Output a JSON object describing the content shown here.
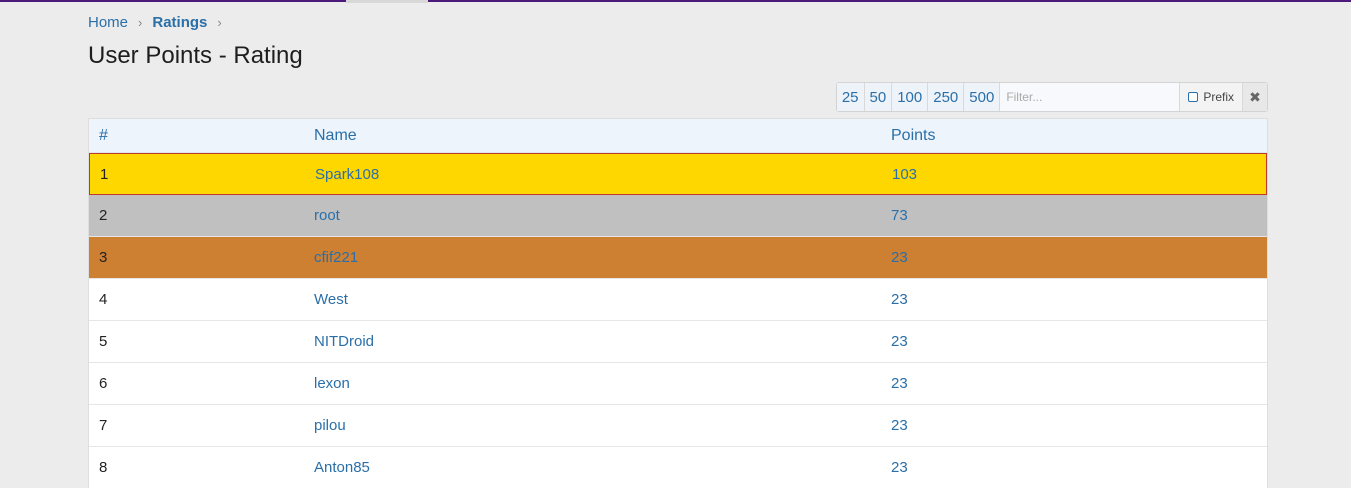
{
  "breadcrumb": {
    "home": "Home",
    "ratings": "Ratings",
    "separator": "›"
  },
  "page": {
    "title": "User Points - Rating"
  },
  "toolbar": {
    "page_sizes": [
      "25",
      "50",
      "100",
      "250",
      "500"
    ],
    "filter_placeholder": "Filter...",
    "prefix_label": "Prefix",
    "clear_icon": "✖"
  },
  "table": {
    "headers": {
      "rank": "#",
      "name": "Name",
      "points": "Points"
    },
    "rows": [
      {
        "rank": "1",
        "name": "Spark108",
        "points": "103"
      },
      {
        "rank": "2",
        "name": "root",
        "points": "73"
      },
      {
        "rank": "3",
        "name": "cfif221",
        "points": "23"
      },
      {
        "rank": "4",
        "name": "West",
        "points": "23"
      },
      {
        "rank": "5",
        "name": "NITDroid",
        "points": "23"
      },
      {
        "rank": "6",
        "name": "lexon",
        "points": "23"
      },
      {
        "rank": "7",
        "name": "pilou",
        "points": "23"
      },
      {
        "rank": "8",
        "name": "Anton85",
        "points": "23"
      }
    ],
    "row_colors": {
      "gold": "#ffd700",
      "silver": "#c0c0c0",
      "bronze": "#cd7f32",
      "default": "#ffffff"
    },
    "highlight_border": "#c0392b"
  },
  "colors": {
    "accent": "#2a6fa8",
    "top_bar": "#4b1a7a",
    "background": "#ececec"
  }
}
